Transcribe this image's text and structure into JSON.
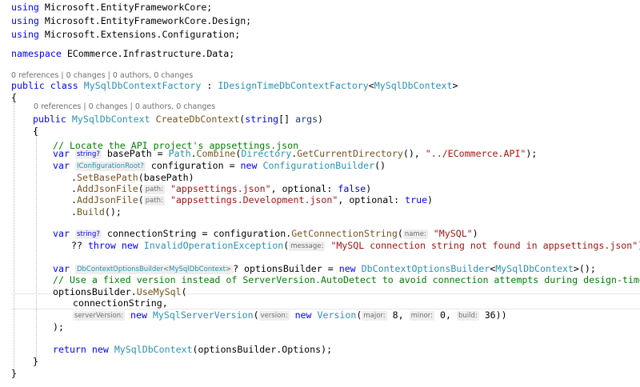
{
  "usings": [
    {
      "kw": "using",
      "ns": "Microsoft.EntityFrameworkCore;"
    },
    {
      "kw": "using",
      "ns": "Microsoft.EntityFrameworkCore.Design;"
    },
    {
      "kw": "using",
      "ns": "Microsoft.Extensions.Configuration;"
    }
  ],
  "namespace": {
    "kw": "namespace",
    "name": "ECommerce.Infrastructure.Data;"
  },
  "class_lens": {
    "references": "0 references",
    "changes": "0 changes",
    "authors": "0 authors, 0 changes"
  },
  "class_decl": {
    "kw1": "public",
    "kw2": "class",
    "name": "MySqlDbContextFactory",
    "sep": " : ",
    "iface": "IDesignTimeDbContextFactory",
    "lt": "<",
    "targ": "MySqlDbContext",
    "gt": ">"
  },
  "method_lens": {
    "references": "0 references",
    "changes": "0 changes",
    "authors": "0 authors, 0 changes"
  },
  "method_decl": {
    "kw": "public",
    "type": "MySqlDbContext",
    "name": "CreateDbContext",
    "open": "(",
    "ptype": "string",
    "arr": "[] ",
    "param": "args",
    "close": ")"
  },
  "brace_open": "{",
  "brace_close": "}",
  "comment1": "// Locate the API project's appsettings.json",
  "l_basepath": {
    "var": "var",
    "hint": "string?",
    "name": "basePath",
    "eq": " = ",
    "cls": "Path",
    "dot": ".",
    "m1": "Combine",
    "p1": "(",
    "cls2": "Directory",
    "dot2": ".",
    "m2": "GetCurrentDirectory",
    "p2": "(), ",
    "str": "\"../ECommerce.API\"",
    "end": ");"
  },
  "l_config": {
    "var": "var",
    "hint": "IConfigurationRoot?",
    "name": "configuration",
    "eq": " = ",
    "kw_new": "new",
    "cls": "ConfigurationBuilder",
    "end": "()"
  },
  "l_setbase": {
    "dot": ".",
    "m": "SetBasePath",
    "p": "(",
    "arg": "basePath",
    "end": ")"
  },
  "l_add1": {
    "dot": ".",
    "m": "AddJsonFile",
    "p": "(",
    "hint": "path:",
    "str": "\"appsettings.json\"",
    "mid": ", ",
    "named": "optional",
    "colon": ": ",
    "val": "false",
    "end": ")"
  },
  "l_add2": {
    "dot": ".",
    "m": "AddJsonFile",
    "p": "(",
    "hint": "path:",
    "str": "\"appsettings.Development.json\"",
    "mid": ", ",
    "named": "optional",
    "colon": ": ",
    "val": "true",
    "end": ")"
  },
  "l_build": {
    "dot": ".",
    "m": "Build",
    "end": "();"
  },
  "l_connstr": {
    "var": "var",
    "hint": "string?",
    "name": "connectionString",
    "eq": " = ",
    "obj": "configuration",
    "dot": ".",
    "m": "GetConnectionString",
    "p": "(",
    "hint2": "name:",
    "str": "\"MySQL\"",
    "end": ")"
  },
  "l_throw": {
    "qq": "?? ",
    "kw_throw": "throw",
    "kw_new": "new",
    "cls": "InvalidOperationException",
    "p": "(",
    "hint": "message:",
    "str": "\"MySQL connection string not found in appsettings.json\"",
    "end": ");"
  },
  "l_optb": {
    "var": "var",
    "hint_cls": "DbContextOptionsBuilder",
    "hint_lt": "<",
    "hint_arg": "MySqlDbContext",
    "hint_gt": ">",
    "q": "?",
    "name": "optionsBuilder",
    "eq": " = ",
    "kw_new": "new",
    "cls": "DbContextOptionsBuilder",
    "lt": "<",
    "arg": "MySqlDbContext",
    "end": ">();"
  },
  "comment2": "// Use a fixed version instead of ServerVersion.AutoDetect to avoid connection attempts during design-time",
  "l_usemysql": {
    "obj": "optionsBuilder",
    "dot": ".",
    "m": "UseMySql",
    "p": "("
  },
  "l_connarg": {
    "arg": "connectionString",
    "comma": ","
  },
  "l_version": {
    "hint": "serverVersion:",
    "kw_new": "new",
    "cls": "MySqlServerVersion",
    "p": "(",
    "hint2": "version:",
    "kw_new2": "new",
    "cls2": "Version",
    "p2": "(",
    "h_major": "major:",
    "v_major": "8",
    "c1": ", ",
    "h_minor": "minor:",
    "v_minor": "0",
    "c2": ", ",
    "h_build": "build:",
    "v_build": "36",
    "end": "))"
  },
  "l_closeparen": ");",
  "l_return": {
    "kw": "return",
    "kw_new": "new",
    "cls": "MySqlDbContext",
    "p": "(",
    "obj": "optionsBuilder",
    "dot": ".",
    "prop": "Options",
    "end": ");"
  }
}
